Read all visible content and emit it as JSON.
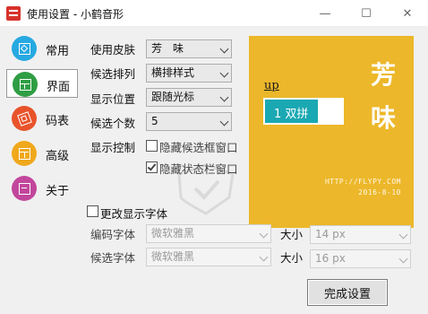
{
  "window": {
    "title": "使用设置 - 小鹤音形",
    "minimize_glyph": "—",
    "maximize_glyph": "☐",
    "close_glyph": "✕"
  },
  "nav": {
    "items": [
      {
        "label": "常用",
        "icon": "square-icon",
        "color": "#27a9e1"
      },
      {
        "label": "界面",
        "icon": "layout-icon",
        "color": "#2f9e44"
      },
      {
        "label": "码表",
        "icon": "table-icon",
        "color": "#e8532b"
      },
      {
        "label": "高级",
        "icon": "window-icon",
        "color": "#f0a81c"
      },
      {
        "label": "关于",
        "icon": "about-icon",
        "color": "#c2479c"
      }
    ],
    "active": "界面"
  },
  "settings": {
    "skin": {
      "label": "使用皮肤",
      "value": "芳　味"
    },
    "arrangement": {
      "label": "候选排列",
      "value": "横排样式"
    },
    "position": {
      "label": "显示位置",
      "value": "跟随光标"
    },
    "count": {
      "label": "候选个数",
      "value": "5"
    },
    "display_control": {
      "label": "显示控制",
      "hide_candidate_window": {
        "label": "隐藏候选框窗口",
        "checked": false
      },
      "hide_status_bar": {
        "label": "隐藏状态栏窗口",
        "checked": true
      }
    }
  },
  "font": {
    "change_label": "更改显示字体",
    "change_checked": false,
    "code_font": {
      "label": "编码字体",
      "value": "微软雅黑",
      "size_label": "大小",
      "size_value": "14 px"
    },
    "candidate_font": {
      "label": "候选字体",
      "value": "微软雅黑",
      "size_label": "大小",
      "size_value": "16 px"
    }
  },
  "preview": {
    "code_text": "up",
    "candidate_text": "1 双拼",
    "big_char_1": "芳",
    "big_char_2": "味",
    "url": "HTTP://FLYPY.COM",
    "date": "2016-8-10",
    "bg_color": "#ecb72a",
    "box_color": "#1aa8b3"
  },
  "buttons": {
    "finish": "完成设置"
  }
}
